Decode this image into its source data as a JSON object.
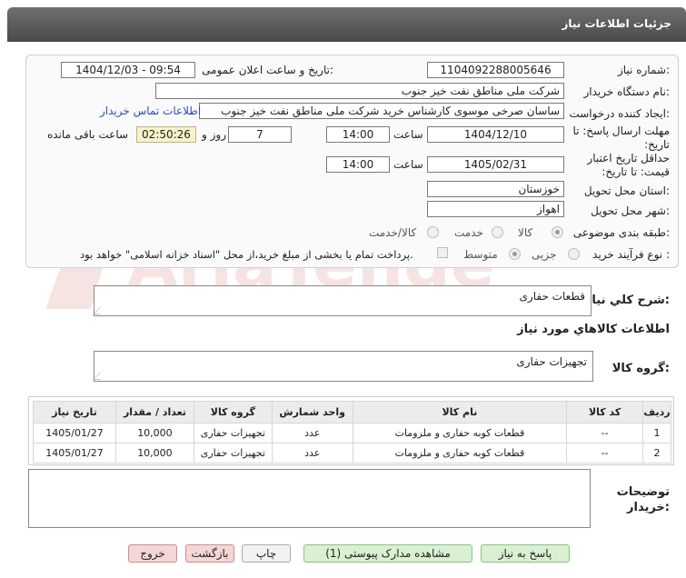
{
  "header": {
    "title": "جزئیات اطلاعات نیاز"
  },
  "form": {
    "need_number": {
      "label": "شماره نیاز:",
      "value": "1104092288005646"
    },
    "announce_datetime": {
      "label": "تاریخ و ساعت اعلان عمومی:",
      "value": "1404/12/03 - 09:54"
    },
    "buyer_org": {
      "label": "نام دستگاه خریدار:",
      "value": "شرکت ملی مناطق نفت خیز جنوب"
    },
    "requester": {
      "label": "ایجاد کننده درخواست:",
      "value": "ساسان صرخی موسوی کارشناس خرید  شرکت ملی مناطق نفت خیز جنوب"
    },
    "contact_link": "اطلاعات تماس خریدار",
    "deadline": {
      "label": "مهلت ارسال پاسخ: تا تاریخ:",
      "date": "1404/12/10",
      "time_label": "ساعت",
      "time": "14:00",
      "days": "7",
      "days_label": "روز و",
      "remaining": "02:50:26",
      "remaining_label": "ساعت باقی مانده"
    },
    "validity": {
      "label": "حداقل تاریخ اعتبار قیمت: تا تاریخ:",
      "date": "1405/02/31",
      "time_label": "ساعت",
      "time": "14:00"
    },
    "province": {
      "label": "استان محل تحویل:",
      "value": "خوزستان"
    },
    "city": {
      "label": "شهر محل تحویل:",
      "value": "اهواز"
    },
    "category": {
      "label": "طبقه بندی موضوعی:",
      "options": [
        "کالا",
        "خدمت",
        "کالا/خدمت"
      ],
      "selected": "کالا"
    },
    "purchase_type": {
      "label": "نوع فرآیند خرید :",
      "options": [
        "جزیی",
        "متوسط"
      ],
      "selected": "متوسط",
      "note": "پرداخت تمام یا بخشی از مبلغ خرید،از محل \"اسناد خزانه اسلامی\" خواهد بود."
    }
  },
  "description": {
    "label": "شرح كلي نياز:",
    "value": "قطعات حفاری"
  },
  "goods_info_title": "اطلاعات كالاهاي مورد نياز",
  "goods_group": {
    "label": "گروه كالا:",
    "value": "تجهیزات حفاری"
  },
  "table": {
    "headers": [
      "ردیف",
      "کد کالا",
      "نام کالا",
      "واحد شمارش",
      "گروه کالا",
      "تعداد / مقدار",
      "تاریخ نیاز"
    ],
    "rows": [
      [
        "1",
        "--",
        "قطعات کوبه حفاری و ملزومات",
        "عدد",
        "تجهیزات حفاری",
        "10,000",
        "1405/01/27"
      ],
      [
        "2",
        "--",
        "قطعات کوبه حفاری و ملزومات",
        "عدد",
        "تجهیزات حفاری",
        "10,000",
        "1405/01/27"
      ]
    ]
  },
  "buyer_notes": {
    "label_1": "توضیحات",
    "label_2": "خریدار:",
    "value": ""
  },
  "buttons": {
    "respond": "پاسخ به نیاز",
    "attachments": "مشاهده مدارک پیوستی (1)",
    "print": "چاپ",
    "back": "بازگشت",
    "exit": "خروج"
  },
  "watermark_text": "AriaTender.neT",
  "colors": {
    "title_bar": "#5a5a5a",
    "link": "#2a4bbd",
    "remaining_bg": "#f7f3c8",
    "button_green": "#d9f0d2",
    "button_red": "#f5d6d6"
  }
}
